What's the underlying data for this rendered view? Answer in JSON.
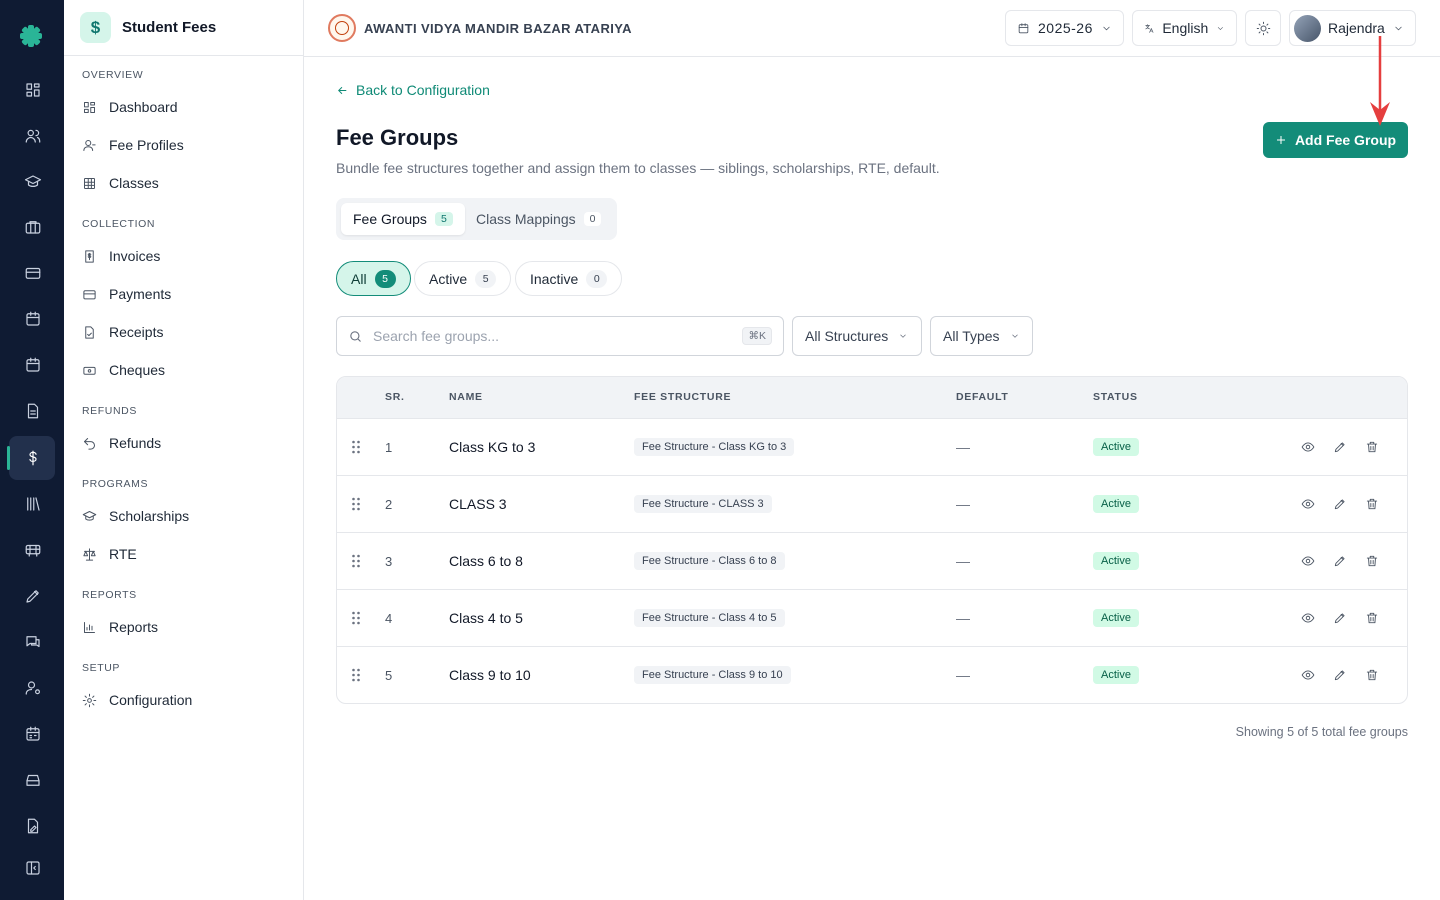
{
  "rail": {
    "icons": [
      "dashboard-icon",
      "users-icon",
      "graduation-cap-icon",
      "briefcase-icon",
      "credit-card-icon",
      "calendar-icon",
      "calendar-alt-icon",
      "document-icon",
      "dollar-icon",
      "library-icon",
      "bus-icon",
      "pen-tool-icon",
      "messages-icon",
      "user-settings-icon",
      "schedule-icon",
      "storage-icon",
      "file-edit-icon",
      "collapse-sidebar-icon"
    ]
  },
  "sidebar": {
    "title": "Student Fees",
    "logo_glyph": "$",
    "sections": [
      {
        "label": "OVERVIEW",
        "items": [
          {
            "label": "Dashboard",
            "icon": "dashboard-icon"
          },
          {
            "label": "Fee Profiles",
            "icon": "user-icon"
          },
          {
            "label": "Classes",
            "icon": "grid-icon"
          }
        ]
      },
      {
        "label": "COLLECTION",
        "items": [
          {
            "label": "Invoices",
            "icon": "invoice-icon"
          },
          {
            "label": "Payments",
            "icon": "credit-card-icon"
          },
          {
            "label": "Receipts",
            "icon": "receipt-icon"
          },
          {
            "label": "Cheques",
            "icon": "cheque-icon"
          }
        ]
      },
      {
        "label": "REFUNDS",
        "items": [
          {
            "label": "Refunds",
            "icon": "undo-icon"
          }
        ]
      },
      {
        "label": "PROGRAMS",
        "items": [
          {
            "label": "Scholarships",
            "icon": "graduation-cap-icon"
          },
          {
            "label": "RTE",
            "icon": "scale-icon"
          }
        ]
      },
      {
        "label": "REPORTS",
        "items": [
          {
            "label": "Reports",
            "icon": "bar-chart-icon"
          }
        ]
      },
      {
        "label": "SETUP",
        "items": [
          {
            "label": "Configuration",
            "icon": "gear-icon"
          }
        ]
      }
    ]
  },
  "topbar": {
    "school_name": "AWANTI VIDYA MANDIR BAZAR ATARIYA",
    "session": "2025-26",
    "language": "English",
    "user_name": "Rajendra"
  },
  "main": {
    "back_label": "Back to Configuration",
    "title": "Fee Groups",
    "description": "Bundle fee structures together and assign them to classes — siblings, scholarships, RTE, default.",
    "add_button": "Add Fee Group",
    "tabs": [
      {
        "label": "Fee Groups",
        "count": "5",
        "active": true
      },
      {
        "label": "Class Mappings",
        "count": "0",
        "active": false
      }
    ],
    "filters": [
      {
        "label": "All",
        "count": "5",
        "active": true
      },
      {
        "label": "Active",
        "count": "5",
        "active": false
      },
      {
        "label": "Inactive",
        "count": "0",
        "active": false
      }
    ],
    "search_placeholder": "Search fee groups...",
    "search_shortcut": "⌘K",
    "structure_select": "All Structures",
    "type_select": "All Types",
    "table": {
      "headers": {
        "sr": "SR.",
        "name": "NAME",
        "structure": "FEE STRUCTURE",
        "default": "DEFAULT",
        "status": "STATUS"
      },
      "rows": [
        {
          "sr": "1",
          "name": "Class KG to 3",
          "structure": "Fee Structure - Class KG to 3",
          "default": "—",
          "status": "Active"
        },
        {
          "sr": "2",
          "name": "CLASS 3",
          "structure": "Fee Structure - CLASS 3",
          "default": "—",
          "status": "Active"
        },
        {
          "sr": "3",
          "name": "Class 6 to 8",
          "structure": "Fee Structure - Class 6 to 8",
          "default": "—",
          "status": "Active"
        },
        {
          "sr": "4",
          "name": "Class 4 to 5",
          "structure": "Fee Structure - Class 4 to 5",
          "default": "—",
          "status": "Active"
        },
        {
          "sr": "5",
          "name": "Class 9 to 10",
          "structure": "Fee Structure - Class 9 to 10",
          "default": "—",
          "status": "Active"
        }
      ]
    },
    "footer_note": "Showing 5 of 5 total fee groups"
  },
  "colors": {
    "rail_bg": "#0f1b33",
    "accent": "#138c79",
    "annotation_arrow": "#e53e3e"
  }
}
